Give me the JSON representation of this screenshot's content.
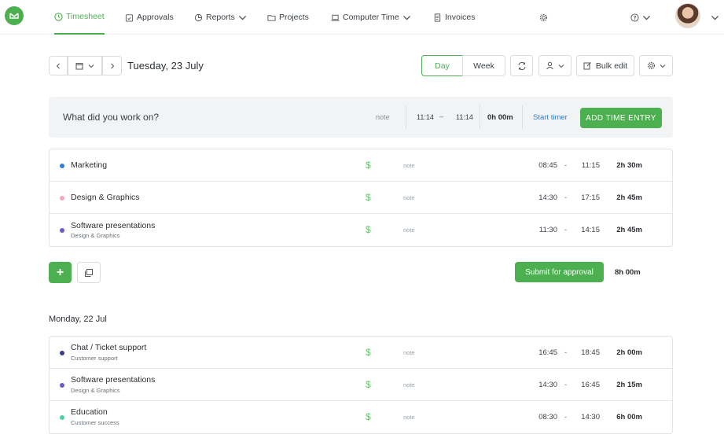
{
  "nav": {
    "items": [
      {
        "label": "Timesheet",
        "icon": "clock-icon"
      },
      {
        "label": "Approvals",
        "icon": "calendar-check-icon"
      },
      {
        "label": "Reports",
        "icon": "pie-chart-icon"
      },
      {
        "label": "Projects",
        "icon": "folder-icon"
      },
      {
        "label": "Computer Time",
        "icon": "laptop-icon"
      },
      {
        "label": "Invoices",
        "icon": "invoice-icon"
      }
    ]
  },
  "datebar": {
    "date": "Tuesday, 23 July",
    "view_day": "Day",
    "view_week": "Week",
    "bulk_edit": "Bulk edit"
  },
  "entry": {
    "placeholder": "What did you work on?",
    "note": "note",
    "start": "11:14",
    "dash": "–",
    "end": "11:14",
    "duration": "0h 00m",
    "start_timer": "Start timer",
    "add_label": "ADD TIME ENTRY"
  },
  "today": {
    "rows": [
      {
        "project": "Marketing",
        "client": "",
        "dot": "#2f7de1",
        "note": "note",
        "start": "08:45",
        "dash": "-",
        "end": "11:15",
        "duration": "2h 30m"
      },
      {
        "project": "Design & Graphics",
        "client": "",
        "dot": "#f2a7c0",
        "note": "note",
        "start": "14:30",
        "dash": "-",
        "end": "17:15",
        "duration": "2h 45m"
      },
      {
        "project": "Software presentations",
        "client": "Design & Graphics",
        "dot": "#6a5acd",
        "note": "note",
        "start": "11:30",
        "dash": "-",
        "end": "14:15",
        "duration": "2h 45m"
      }
    ],
    "submit": "Submit for approval",
    "total": "8h 00m"
  },
  "previous": {
    "title": "Monday, 22 Jul",
    "rows": [
      {
        "project": "Chat / Ticket support",
        "client": "Customer support",
        "dot": "#3b3f8f",
        "note": "note",
        "start": "16:45",
        "dash": "-",
        "end": "18:45",
        "duration": "2h 00m"
      },
      {
        "project": "Software presentations",
        "client": "Design & Graphics",
        "dot": "#6a5acd",
        "note": "note",
        "start": "14:30",
        "dash": "-",
        "end": "16:45",
        "duration": "2h 15m"
      },
      {
        "project": "Education",
        "client": "Customer success",
        "dot": "#4cd3a5",
        "note": "note",
        "start": "08:30",
        "dash": "-",
        "end": "14:30",
        "duration": "6h 00m"
      }
    ]
  },
  "colors": {
    "accent": "#4caf50",
    "link": "#2f7de1"
  },
  "symbols": {
    "dollar": "$",
    "plus": "+"
  }
}
